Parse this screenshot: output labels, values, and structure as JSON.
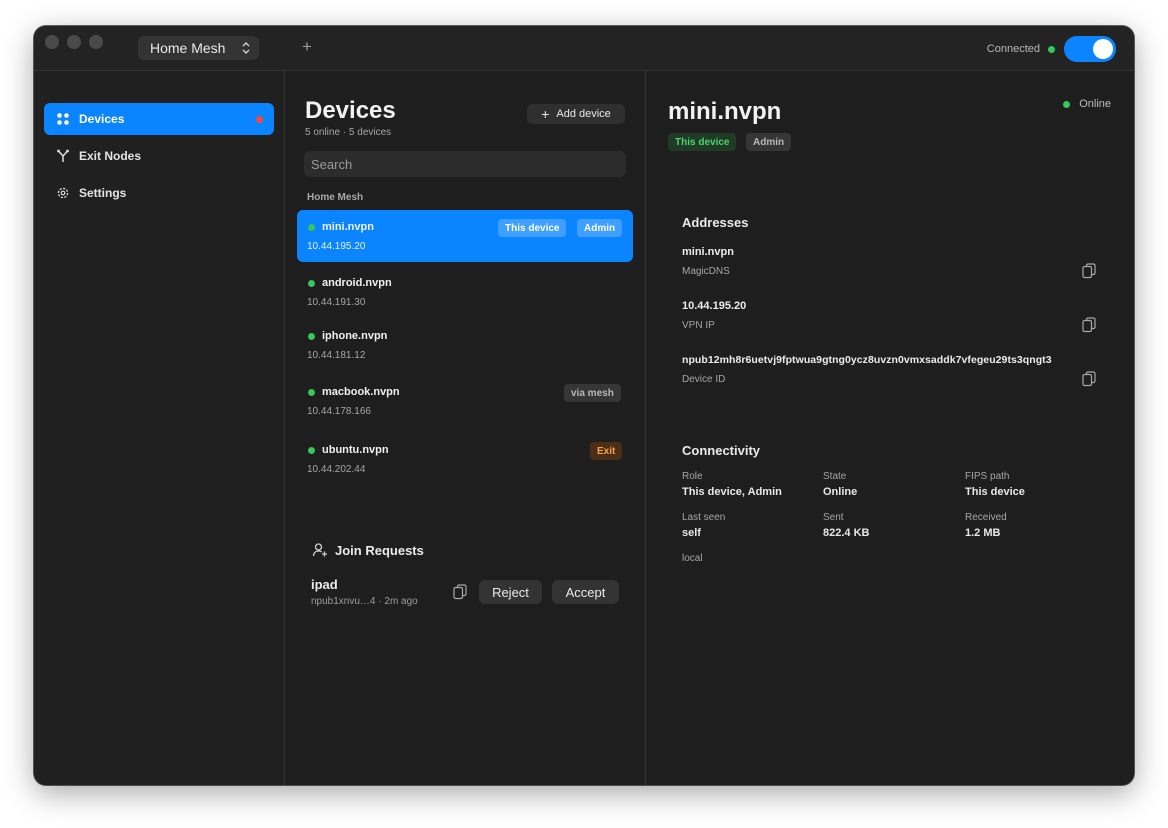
{
  "titlebar": {
    "mesh_name": "Home Mesh",
    "new_tab": "+",
    "connection_label": "Connected",
    "connection_on": true
  },
  "sidebar": {
    "items": [
      {
        "label": "Devices",
        "icon": "grid-icon",
        "active": true,
        "has_badge": true
      },
      {
        "label": "Exit Nodes",
        "icon": "branch-icon",
        "active": false
      },
      {
        "label": "Settings",
        "icon": "gear-icon",
        "active": false
      }
    ]
  },
  "list": {
    "title": "Devices",
    "subtitle": "5 online · 5 devices",
    "add_button": "Add device",
    "search_placeholder": "Search",
    "group_label": "Home Mesh",
    "devices": [
      {
        "name": "mini.nvpn",
        "ip": "10.44.195.20",
        "tags": [
          "This device",
          "Admin"
        ]
      },
      {
        "name": "android.nvpn",
        "ip": "10.44.191.30",
        "tags": []
      },
      {
        "name": "iphone.nvpn",
        "ip": "10.44.181.12",
        "tags": []
      },
      {
        "name": "macbook.nvpn",
        "ip": "10.44.178.166",
        "tags": [
          "via mesh"
        ]
      },
      {
        "name": "ubuntu.nvpn",
        "ip": "10.44.202.44",
        "tags": [
          "Exit"
        ]
      }
    ],
    "join": {
      "title": "Join Requests",
      "name": "ipad",
      "meta": "npub1xnvu…4 · 2m ago",
      "reject": "Reject",
      "accept": "Accept"
    }
  },
  "detail": {
    "title": "mini.nvpn",
    "status": "Online",
    "chips": [
      "This device",
      "Admin"
    ],
    "addresses_title": "Addresses",
    "addresses": [
      {
        "value": "mini.nvpn",
        "label": "MagicDNS"
      },
      {
        "value": "10.44.195.20",
        "label": "VPN IP"
      },
      {
        "value": "npub12mh8r6uetvj9fptwua9gtng0ycz8uvzn0vmxsaddk7vfegeu29ts3qngt3",
        "label": "Device ID"
      }
    ],
    "connectivity_title": "Connectivity",
    "connectivity": [
      {
        "label": "Role",
        "value": "This device, Admin"
      },
      {
        "label": "State",
        "value": "Online"
      },
      {
        "label": "FIPS path",
        "value": "This device"
      },
      {
        "label": "Last seen",
        "value": "self"
      },
      {
        "label": "Sent",
        "value": "822.4 KB"
      },
      {
        "label": "Received",
        "value": "1.2 MB"
      }
    ],
    "footer_note": "local"
  },
  "colors": {
    "accent": "#0a84ff",
    "online": "#34c759",
    "alert": "#ff453a",
    "exit_tag": "#f7a04a"
  }
}
